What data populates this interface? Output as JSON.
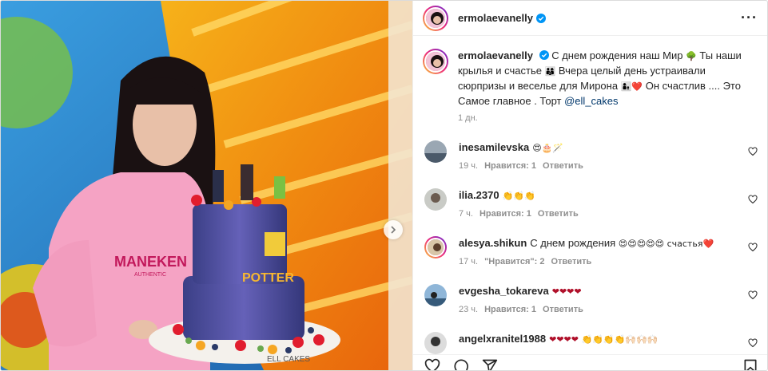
{
  "post": {
    "username": "ermolaevanelly",
    "caption": {
      "part1": "С днем рождения наш Мир",
      "part2": "Ты наши крылья и счастье",
      "part3": "Вчера целый день устраивали сюрпризы и веселье для Мирона",
      "part4": "Он счастлив .... Это Самое главное . Торт",
      "mention": "@ell_cakes",
      "emoji_a": "🌳",
      "emoji_b": "👨‍👩‍👦",
      "emoji_c": "👩‍👦❤️"
    },
    "time": "1 дн.",
    "more_label": "···"
  },
  "comments": [
    {
      "username": "inesamilevska",
      "text": "",
      "emoji": "😍🎂🪄",
      "time": "19 ч.",
      "likes": "Нравится: 1",
      "reply": "Ответить"
    },
    {
      "username": "ilia.2370",
      "text": "",
      "emoji": "👏👏👏",
      "time": "7 ч.",
      "likes": "Нравится: 1",
      "reply": "Ответить"
    },
    {
      "username": "alesya.shikun",
      "text": "С днем рождения",
      "emoji": "😍😍😍😍😍 счастья❤️",
      "time": "17 ч.",
      "likes": "\"Нравится\": 2",
      "reply": "Ответить"
    },
    {
      "username": "evgesha_tokareva",
      "text": "",
      "emoji": "❤❤❤❤",
      "time": "23 ч.",
      "likes": "Нравится: 1",
      "reply": "Ответить"
    },
    {
      "username": "angelxranitel1988",
      "text": "",
      "emoji": "❤❤❤❤ 👏👏👏👏🙌🏻🙌🏻🙌🏻",
      "time": "",
      "likes": "",
      "reply": ""
    }
  ],
  "photo": {
    "cake_brand": "ELL CAKES",
    "hoodie_text": "MANEKEN",
    "hoodie_sub": "AUTHENTIC",
    "cake_topper": "POTTER"
  },
  "colors": {
    "accent": "#0095f6",
    "link": "#00376b",
    "heart": "#b0102a",
    "muted": "#8e8e8e"
  },
  "icons": [
    "verified-icon",
    "more-icon",
    "heart-icon",
    "comment-icon",
    "share-icon",
    "save-icon",
    "chevron-right-icon"
  ]
}
